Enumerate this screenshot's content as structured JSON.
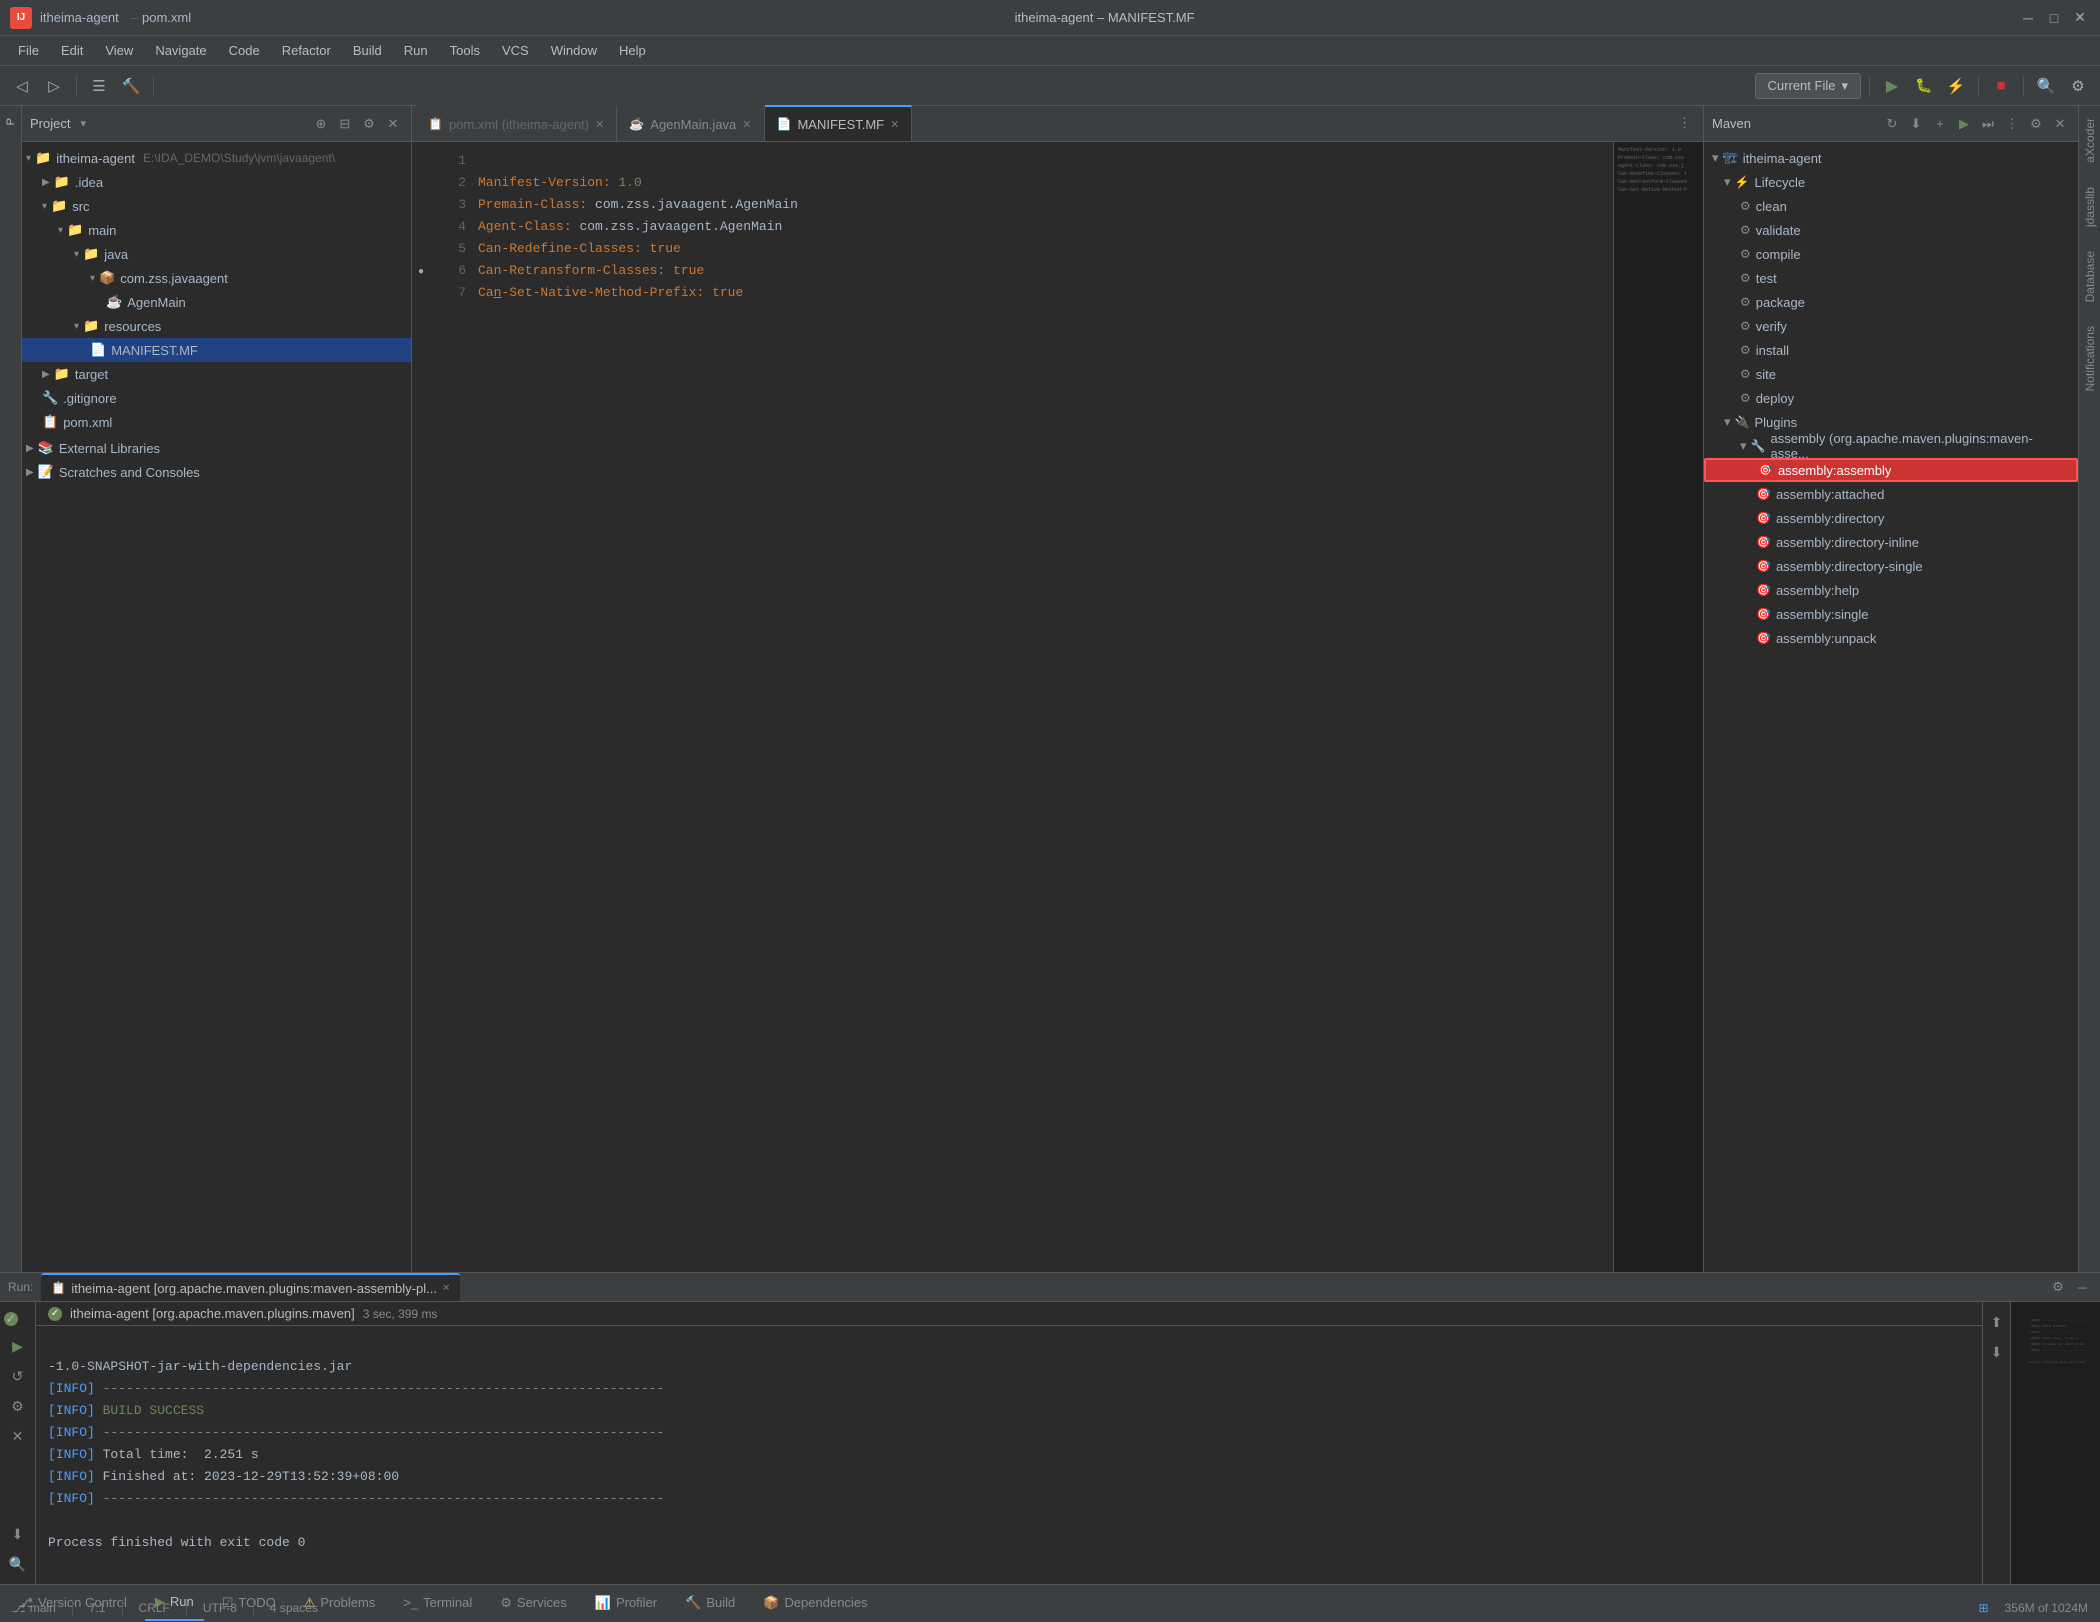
{
  "titlebar": {
    "app_icon": "IJ",
    "project": "itheima-agent",
    "separator": "–",
    "file": "pom.xml",
    "window_title": "itheima-agent – MANIFEST.MF",
    "minimize": "─",
    "maximize": "□",
    "close": "✕"
  },
  "menubar": {
    "items": [
      "File",
      "Edit",
      "View",
      "Navigate",
      "Code",
      "Refactor",
      "Build",
      "Run",
      "Tools",
      "VCS",
      "Window",
      "Help"
    ]
  },
  "toolbar": {
    "current_file_label": "Current File",
    "chevron": "▾"
  },
  "project_panel": {
    "title": "Project",
    "root": "itheima-agent",
    "root_path": "E:\\IDA_DEMO\\Study\\jvm\\javaagent\\",
    "tree": [
      {
        "level": 1,
        "label": ".idea",
        "type": "folder",
        "expanded": false
      },
      {
        "level": 1,
        "label": "src",
        "type": "folder",
        "expanded": true
      },
      {
        "level": 2,
        "label": "main",
        "type": "folder",
        "expanded": true
      },
      {
        "level": 3,
        "label": "java",
        "type": "folder",
        "expanded": true
      },
      {
        "level": 4,
        "label": "com.zss.javaagent",
        "type": "package",
        "expanded": true
      },
      {
        "level": 5,
        "label": "AgenMain",
        "type": "java"
      },
      {
        "level": 3,
        "label": "resources",
        "type": "folder",
        "expanded": true
      },
      {
        "level": 4,
        "label": "MANIFEST.MF",
        "type": "mf",
        "selected": true
      },
      {
        "level": 1,
        "label": "target",
        "type": "folder",
        "expanded": false
      },
      {
        "level": 1,
        "label": ".gitignore",
        "type": "git"
      },
      {
        "level": 1,
        "label": "pom.xml",
        "type": "xml"
      },
      {
        "level": 0,
        "label": "External Libraries",
        "type": "lib",
        "expanded": false
      },
      {
        "level": 0,
        "label": "Scratches and Consoles",
        "type": "scratch",
        "expanded": false
      }
    ]
  },
  "editor": {
    "tabs": [
      {
        "label": "pom.xml",
        "project": "itheima-agent",
        "type": "xml",
        "active": false
      },
      {
        "label": "AgenMain.java",
        "type": "java",
        "active": false
      },
      {
        "label": "MANIFEST.MF",
        "type": "mf",
        "active": true
      }
    ],
    "lines": [
      {
        "num": 1,
        "content": "Manifest-Version: 1.0"
      },
      {
        "num": 2,
        "content": "Premain-Class: com.zss.javaagent.AgenMain"
      },
      {
        "num": 3,
        "content": "Agent-Class: com.zss.javaagent.AgenMain"
      },
      {
        "num": 4,
        "content": "Can-Redefine-Classes: true"
      },
      {
        "num": 5,
        "content": "Can-Retransform-Classes: true"
      },
      {
        "num": 6,
        "content": "Can-Set-Native-Method-Prefix: true"
      },
      {
        "num": 7,
        "content": ""
      }
    ]
  },
  "maven_panel": {
    "title": "Maven",
    "root": "itheima-agent",
    "lifecycle_label": "Lifecycle",
    "lifecycle_items": [
      "clean",
      "validate",
      "compile",
      "test",
      "package",
      "verify",
      "install",
      "site",
      "deploy"
    ],
    "plugins_label": "Plugins",
    "assembly_label": "assembly (org.apache.maven.plugins:maven-asse...",
    "assembly_goals": [
      {
        "label": "assembly:assembly",
        "selected": true
      },
      {
        "label": "assembly:attached"
      },
      {
        "label": "assembly:directory"
      },
      {
        "label": "assembly:directory-inline"
      },
      {
        "label": "assembly:directory-single"
      },
      {
        "label": "assembly:help"
      },
      {
        "label": "assembly:single"
      },
      {
        "label": "assembly:unpack"
      }
    ]
  },
  "right_sidebar": {
    "tabs": [
      "Notifications",
      "Database",
      "jdasslib",
      "aXcoder"
    ]
  },
  "run_panel": {
    "tab_label": "itheima-agent [org.apache.maven.plugins:maven-assembly-pl...",
    "run_indicator_label": "itheima-agent [org.apache.maven.plugins.maven]",
    "run_time": "3 sec, 399 ms",
    "console_lines": [
      "-1.0-SNAPSHOT-jar-with-dependencies.jar",
      "[INFO] ------------------------------------------------------------------------",
      "[INFO] BUILD SUCCESS",
      "[INFO] ------------------------------------------------------------------------",
      "[INFO] Total time:  2.251 s",
      "[INFO] Finished at: 2023-12-29T13:52:39+08:00",
      "[INFO] ------------------------------------------------------------------------",
      "",
      "Process finished with exit code 0"
    ]
  },
  "bottom_tabs": {
    "items": [
      {
        "label": "Version Control",
        "icon": "⎇",
        "active": false
      },
      {
        "label": "Run",
        "icon": "▶",
        "active": true
      },
      {
        "label": "TODO",
        "icon": "☑",
        "active": false
      },
      {
        "label": "Problems",
        "icon": "⚠",
        "active": false
      },
      {
        "label": "Terminal",
        "icon": ">_",
        "active": false
      },
      {
        "label": "Services",
        "icon": "⚙",
        "active": false
      },
      {
        "label": "Profiler",
        "icon": "📊",
        "active": false
      },
      {
        "label": "Build",
        "icon": "🔨",
        "active": false
      },
      {
        "label": "Dependencies",
        "icon": "📦",
        "active": false
      }
    ]
  },
  "status_bar": {
    "line_col": "7:1",
    "encoding": "CRLF",
    "charset": "UTF-8",
    "indent": "4 spaces"
  }
}
